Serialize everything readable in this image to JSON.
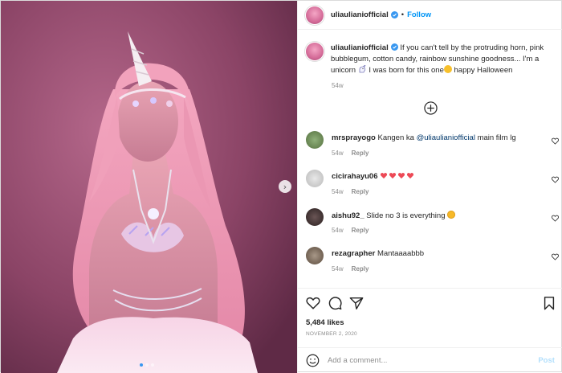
{
  "post": {
    "username": "uliaulianiofficial",
    "follow_label": "Follow",
    "separator": "•",
    "caption_text": " If you can't tell by the protruding horn, pink bubblegum, cotton candy, rainbow sunshine goodness... I'm a unicorn ",
    "caption_end": " I was born for this one",
    "caption_tail": " happy Halloween",
    "caption_time": "54w",
    "likes": "5,484 likes",
    "date": "NOVEMBER 2, 2020",
    "carousel": {
      "slides": 3,
      "current": 1
    }
  },
  "comments": [
    {
      "user": "mrsprayogo",
      "text_before": "Kangen ka ",
      "mention": "@uliaulianiofficial",
      "text_after": " main film lg",
      "time": "54w",
      "reply": "Reply",
      "avatar_color": "#6b8e5a"
    },
    {
      "user": "cicirahayu06",
      "text_before": "",
      "mention": "",
      "text_after": "",
      "hearts": 4,
      "time": "54w",
      "reply": "Reply",
      "avatar_color": "#c9c9c9"
    },
    {
      "user": "aishu92_",
      "text_before": "Slide no 3 is everything ",
      "mention": "",
      "text_after": "",
      "time": "54w",
      "reply": "Reply",
      "avatar_color": "#3a3030"
    },
    {
      "user": "rezagrapher",
      "text_before": "Mantaaaabbb",
      "mention": "",
      "text_after": "",
      "time": "54w",
      "reply": "Reply",
      "avatar_color": "#7a6a5a"
    }
  ],
  "composer": {
    "placeholder": "Add a comment...",
    "post_label": "Post"
  },
  "colors": {
    "accent": "#0095f6",
    "heart": "#ed4956",
    "post_disabled": "#b2dffc"
  },
  "icons": [
    "verified-badge-icon",
    "add-comments-icon",
    "heart-icon",
    "comment-icon",
    "share-icon",
    "bookmark-icon",
    "emoji-icon",
    "chevron-right-icon",
    "unicorn-emoji-icon",
    "tongue-emoji-icon",
    "star-eyes-emoji-icon"
  ]
}
